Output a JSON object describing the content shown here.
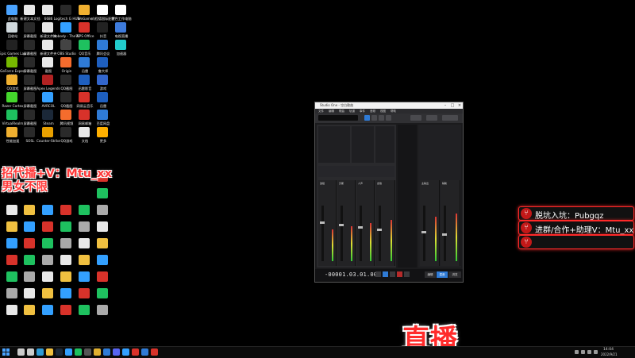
{
  "desktop": {
    "icons": [
      {
        "label": "此电脑",
        "color": "#4aa3ff"
      },
      {
        "label": "新建文本文档",
        "color": "#e8e8e8"
      },
      {
        "label": "6686",
        "color": "#e8e8e8"
      },
      {
        "label": "Logitech G HUB",
        "color": "#2a2a2a"
      },
      {
        "label": "WeGame",
        "color": "#f0b030"
      },
      {
        "label": "向程德国际配置",
        "color": "#ffffff"
      },
      {
        "label": "特色工作电脑",
        "color": "#ffffff"
      },
      {
        "label": "回收站",
        "color": "#cfd8dc"
      },
      {
        "label": "屏幕截图",
        "color": "#2a2a2a"
      },
      {
        "label": "新建文件夹",
        "color": "#e8e8e8"
      },
      {
        "label": "Nobody - The Turna...",
        "color": "#33a0ff"
      },
      {
        "label": "WPS Office",
        "color": "#d8322a"
      },
      {
        "label": "抖音",
        "color": "#222222"
      },
      {
        "label": "电视直播",
        "color": "#3e7bdc"
      },
      {
        "label": "Epic Games Launcher",
        "color": "#222222"
      },
      {
        "label": "屏幕截图",
        "color": "#2a2a2a"
      },
      {
        "label": "新建文件夹",
        "color": "#e8e8e8"
      },
      {
        "label": "OBS Studio",
        "color": "#444444"
      },
      {
        "label": "QQ音乐",
        "color": "#1ec15f"
      },
      {
        "label": "腾讯会议",
        "color": "#2f7bd6"
      },
      {
        "label": "加速器",
        "color": "#22cccc"
      },
      {
        "label": "GeForce Experience",
        "color": "#76b900"
      },
      {
        "label": "屏幕截图",
        "color": "#2a2a2a"
      },
      {
        "label": "截图",
        "color": "#e8e8e8"
      },
      {
        "label": "Origin",
        "color": "#f56c2d"
      },
      {
        "label": "迅雷",
        "color": "#2f7bd6"
      },
      {
        "label": "鲁大师",
        "color": "#1e5fbf"
      },
      {
        "label": "QQ游戏",
        "color": "#f0b030"
      },
      {
        "label": "屏幕截图",
        "color": "#2a2a2a"
      },
      {
        "label": "Apex Legends",
        "color": "#b22222"
      },
      {
        "label": "QQ截图",
        "color": "#2a2a2a"
      },
      {
        "label": "迅雷影音",
        "color": "#1e5fbf"
      },
      {
        "label": "游戏",
        "color": "#3366cc"
      },
      {
        "label": "Razer Cortex",
        "color": "#44d62c"
      },
      {
        "label": "屏幕截图",
        "color": "#2a2a2a"
      },
      {
        "label": "AVRCOL",
        "color": "#33a0ff"
      },
      {
        "label": "QQ截图",
        "color": "#2a2a2a"
      },
      {
        "label": "网易云音乐",
        "color": "#d8322a"
      },
      {
        "label": "迅雷",
        "color": "#1e5fbf"
      },
      {
        "label": "VirtualRealm",
        "color": "#1ec15f"
      },
      {
        "label": "屏幕截图",
        "color": "#2a2a2a"
      },
      {
        "label": "Steam",
        "color": "#1b2838"
      },
      {
        "label": "腾讯视频",
        "color": "#f56c2d"
      },
      {
        "label": "网易邮箱",
        "color": "#d8322a"
      },
      {
        "label": "百度网盘",
        "color": "#2f7bd6"
      },
      {
        "label": "性能加速",
        "color": "#f0b030"
      },
      {
        "label": "SOSL",
        "color": "#2a2a2a"
      },
      {
        "label": "Counter-Strike",
        "color": "#e8a000"
      },
      {
        "label": "QQ游戏",
        "color": "#2a2a2a"
      },
      {
        "label": "文档",
        "color": "#e8e8e8"
      },
      {
        "label": "更多",
        "color": "#ffb000"
      }
    ],
    "promo": {
      "line1": "招代播+V：Mtu_xx",
      "line2": "男女不限"
    },
    "live_label": "直播",
    "cards": [
      {
        "text": "脱坑入坑：Pubgqz"
      },
      {
        "text": "进群/合作+助理V：Mtu_xx"
      },
      {
        "text": ""
      }
    ]
  },
  "studio": {
    "title": "Studio One - 空白歌曲",
    "menus": [
      "文件",
      "编辑",
      "歌曲",
      "轨道",
      "事件",
      "音频",
      "视图",
      "帮助"
    ],
    "channels": [
      "鼓组",
      "贝斯",
      "人声",
      "吉他",
      "主输出",
      "辅助"
    ],
    "timecode": "-00001.03.01.00",
    "buttons": {
      "edit": "编辑",
      "mix": "混音",
      "browse": "浏览"
    }
  },
  "taskbar": {
    "time": "14:04",
    "date": "2022/9/21",
    "apps": [
      {
        "name": "search",
        "color": "#cccccc"
      },
      {
        "name": "task-view",
        "color": "#cccccc"
      },
      {
        "name": "edge",
        "color": "#2f9bd6"
      },
      {
        "name": "explorer",
        "color": "#f0c040"
      },
      {
        "name": "steam",
        "color": "#1b2838"
      },
      {
        "name": "qq",
        "color": "#33a0ff"
      },
      {
        "name": "wechat",
        "color": "#1ec15f"
      },
      {
        "name": "obs",
        "color": "#555555"
      },
      {
        "name": "chrome",
        "color": "#e0b030"
      },
      {
        "name": "studio-one",
        "color": "#2f7bd6"
      },
      {
        "name": "discord",
        "color": "#5865f2"
      },
      {
        "name": "store",
        "color": "#33a0ff"
      },
      {
        "name": "netease",
        "color": "#d8322a"
      },
      {
        "name": "kugou",
        "color": "#2f7bd6"
      },
      {
        "name": "wps",
        "color": "#d8322a"
      }
    ]
  }
}
